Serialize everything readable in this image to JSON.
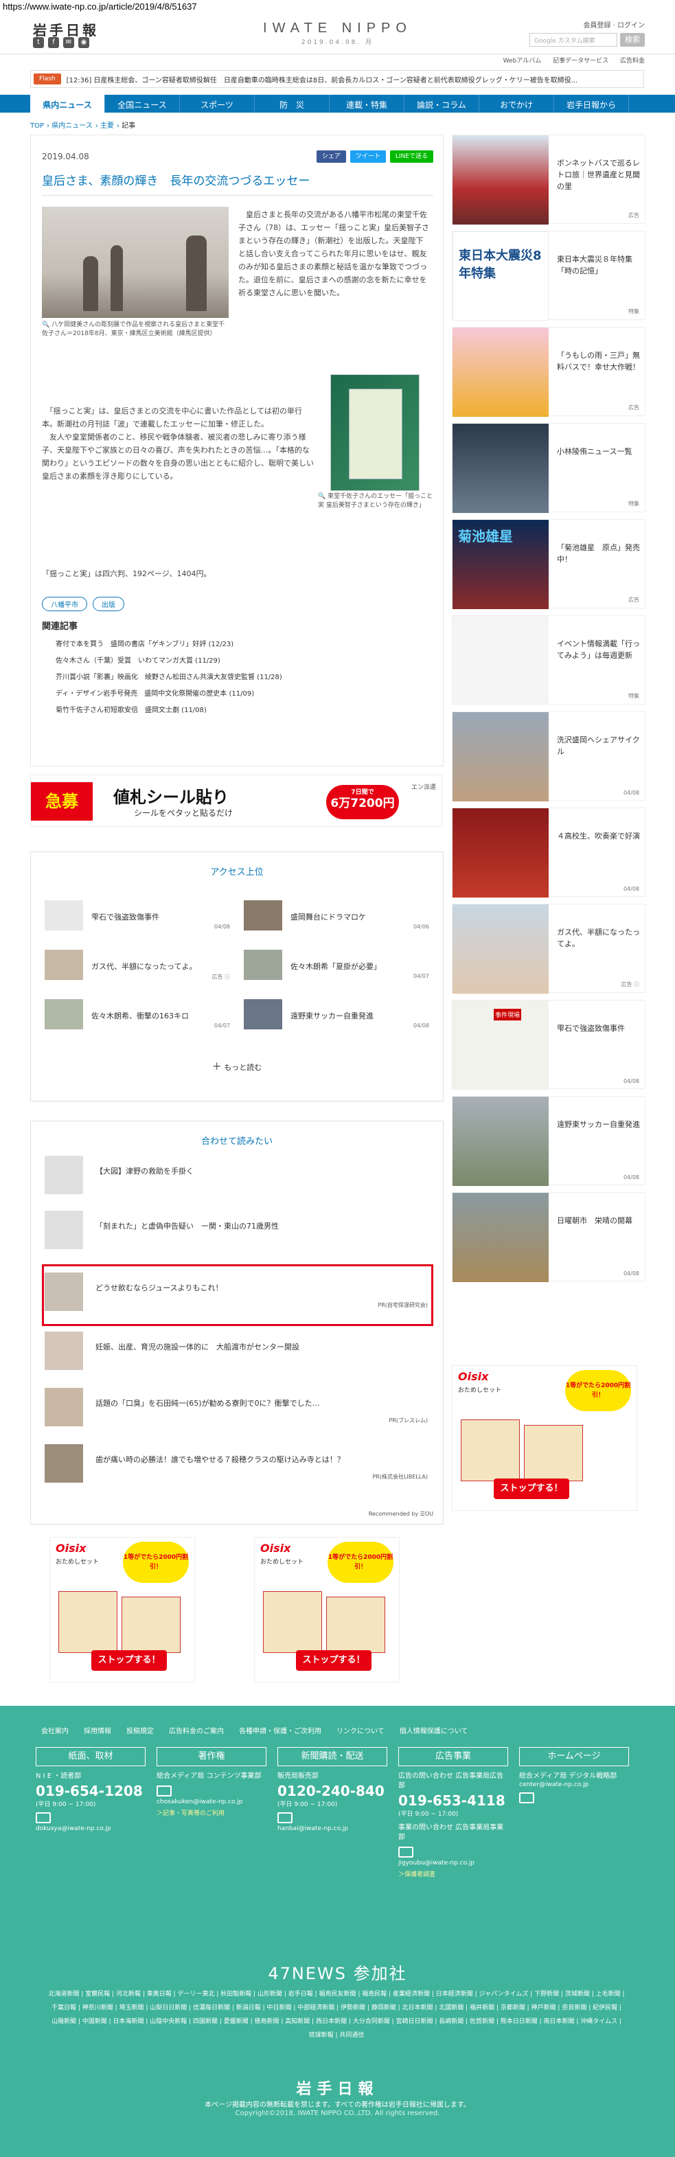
{
  "browser": {
    "url": "https://www.iwate-np.co.jp/article/2019/4/8/51637"
  },
  "header": {
    "logo_left": "岩手日報",
    "logo_center": "IWATE NIPPO",
    "date": "2019.04.08. 月",
    "member": "会員登録 · ログイン",
    "search_placeholder": "Google カスタム検索",
    "search_button": "検索",
    "subnav": [
      "Webアルバム",
      "記事データサービス",
      "広告料金"
    ]
  },
  "flash": {
    "tag": "Flash",
    "text": "[12:36] 日産株主総会、ゴーン容疑者取締役解任　日産自動車の臨時株主総会は8日、前会長カルロス・ゴーン容疑者と前代表取締役グレッグ・ケリー被告を取締役..."
  },
  "nav": [
    "県内ニュース",
    "全国ニュース",
    "スポーツ",
    "防　災",
    "連載・特集",
    "論説・コラム",
    "おでかけ",
    "岩手日報から"
  ],
  "breadcrumb": [
    "TOP",
    "県内ニュース",
    "主要",
    "記事"
  ],
  "article": {
    "date": "2019.04.08",
    "share": {
      "fb": "シェア",
      "tw": "ツイート",
      "line": "LINEで送る"
    },
    "title": "皇后さま、素顔の輝き　長年の交流つづるエッセー",
    "caption1": "八ケ岡健美さんの彫刻展で作品を視察される皇后さまと東堂千佐子さん＝2018年8月、東京・練馬区立美術館（練馬区提供）",
    "para1": "　皇后さまと長年の交流がある八幡平市松尾の東堂千佐子さん（78）は、エッセー「揺っこと実」皇后美智子さまという存在の輝き」（新潮社）を出版した。天皇陛下と話し合い支え合ってこられた年月に思いをはせ、親友のみが知る皇后さまの素顔と秘話を温かな筆致でつづった。退位を前に、皇后さまへの感謝の念を新たに幸せを祈る東堂さんに思いを聞いた。",
    "para2": "　「揺っこと実」は、皇后さまとの交流を中心に書いた作品としては初の単行本。新潮社の月刊誌「波」で連載したエッセーに加筆・修正した。\n　友人や皇室関係者のこと、移民や戦争体験者、被災者の悲しみに寄り添う様子、天皇陛下やご家族との日々の喜び、声を失われたときの苦悩…。「本格的な関わり」というエピソードの数々を自身の思い出とともに紹介し、聡明で美しい皇后さまの素顔を浮き彫りにしている。",
    "caption2": "東堂千佐子さんのエッセー「揺っこと実 皇后美智子さまという存在の輝き」",
    "para3": "「揺っこと実」は四六判、192ページ、1404円。",
    "tags": [
      "八幡平市",
      "出版"
    ],
    "related_heading": "関連記事",
    "related": [
      "寄付で本を買う　盛岡の書店「ゲキンブリ」好評 (12/23)",
      "佐々木さん（千葉）受賞　いわてマンガ大賞 (11/29)",
      "芥川賞小説「影裏」映画化　綾野さん松田さん共演大友啓史監督 (11/28)",
      "ディ・デザイン岩手号発売　盛岡中文化祭開催の歴史本 (11/09)",
      "菊竹千佐子さん初短歌安倍　盛岡文士劇 (11/08)"
    ]
  },
  "ad": {
    "badge": "急募",
    "main": "値札シール貼り",
    "sub": "シールをペタッと貼るだけ",
    "price_line": "7日間で",
    "price": "6万7200円",
    "brand": "エン派遣"
  },
  "ranking": {
    "heading": "アクセス上位",
    "items": [
      {
        "title": "雫石で強盗致傷事件",
        "date": "04/08"
      },
      {
        "title": "盛岡舞台にドラマロケ",
        "date": "04/06"
      },
      {
        "title": "ガス代、半額になったってよ。",
        "date": "広告 ⓘ"
      },
      {
        "title": "佐々木朗希「夏掛が必要」",
        "date": "04/07"
      },
      {
        "title": "佐々木朗希、衝撃の163キロ",
        "date": "04/07"
      },
      {
        "title": "遠野東サッカー自重発進",
        "date": "04/08"
      }
    ],
    "more": "もっと読む"
  },
  "recommend": {
    "heading": "合わせて読みたい",
    "items": [
      {
        "title": "【大図】津野の救助を手掛く",
        "pr": ""
      },
      {
        "title": "「刻まれた」と虚偽申告疑い　一関・東山の71歳男性",
        "pr": ""
      },
      {
        "title": "どうせ飲むならジュースよりもこれ！",
        "pr": "PR(自宅保湿研究会)"
      },
      {
        "title": "妊娠、出産、育児の施設一体的に　大船渡市がセンター開設",
        "pr": ""
      },
      {
        "title": "話題の「口臭」を石田純一(65)が勧める寮則で0に？衝撃でした…",
        "pr": "PR(ブレスレム)"
      },
      {
        "title": "歯が痛い時の必勝法！誰でも増やせる７殺穂クラスの駆け込み寺とは！？",
        "pr": "PR(株式会社LIBELLA)"
      }
    ],
    "credit": "Recommended by ☰OU"
  },
  "oisix": {
    "logo": "Oisix",
    "sub": "おためしセット",
    "circle": "1等がでたら2000円割引！",
    "button": "ストップする！"
  },
  "sidebar": [
    {
      "title": "ボンネットバスで巡るレトロ旅｜世界遺産と見聞の里",
      "date": "広告"
    },
    {
      "title": "東日本大震災８年特集「時の記憶」",
      "date": "特集"
    },
    {
      "title": "「うもしの雨・三戸」無料バスで！幸せ大作戦！",
      "date": "広告"
    },
    {
      "title": "小林陵侑ニュース一覧",
      "date": "特集"
    },
    {
      "title": "「菊池雄星　原点」発売中！",
      "date": "広告"
    },
    {
      "title": "イベント情報満載「行ってみよう」は毎週更新",
      "date": "特集"
    },
    {
      "title": "洗沢盛岡ヘシェアサイクル",
      "date": "04/08"
    },
    {
      "title": "４高校生、吹奏楽で好演",
      "date": "04/08"
    },
    {
      "title": "ガス代、半額になったってよ。",
      "date": "広告 ⓘ"
    },
    {
      "title": "雫石で強盗致傷事件",
      "date": "04/08"
    },
    {
      "title": "遠野東サッカー自重発進",
      "date": "04/08"
    },
    {
      "title": "日曜朝市　栄晴の開幕",
      "date": "04/08"
    }
  ],
  "sidebar_thumb_text": {
    "tohoku": "東日本大震災8年特集",
    "kikuchi": "菊池雄星",
    "jiken": "事件現場"
  },
  "footer": {
    "links": [
      "会社案内",
      "採用情報",
      "投稿規定",
      "広告料金のご案内",
      "各種申請・保護・ご次利用",
      "リンクについて",
      "個人情報保護について"
    ],
    "cols": [
      {
        "h": "紙面、取材",
        "l": "N I E ・読者部",
        "tel": "019-654-1208",
        "s": "(平日 9:00 ~ 17:00)",
        "mail": "dokusya@iwate-np.co.jp",
        "y": ""
      },
      {
        "h": "著作権",
        "l": "総合メディア局 コンテンツ事業部",
        "tel": "",
        "s": "",
        "mail": "chosakuken@iwate-np.co.jp",
        "y": "＞記事・写真等のご利用"
      },
      {
        "h": "新聞購読・配送",
        "l": "販売局販売部",
        "tel": "0120-240-840",
        "s": "(平日 9:00 ~ 17:00)",
        "mail": "hanbai@iwate-np.co.jp",
        "y": ""
      },
      {
        "h": "広告事業",
        "l": "広告の問い合わせ 広告事業局広告部",
        "tel": "019-653-4118",
        "s": "(平日 9:00 ~ 17:00)",
        "mail": "jigyoubu@iwate-np.co.jp",
        "y": "＞保護者調査"
      },
      {
        "h": "ホームページ",
        "l": "総合メディア局 デジタル戦略部",
        "tel": "",
        "s": "",
        "mail": "center@iwate-np.co.jp",
        "y": ""
      }
    ],
    "ads_desk": "事業の問い合わせ 広告事業局事業部",
    "news47": "47NEWS 参加社",
    "papers": "北海道新聞 | 室蘭民報 | 河北新報 | 東奥日報 | デーリー東北 | 秋田魁新報 | 山形新聞 | 岩手日報 | 福島民友新聞 | 福島民報 | 産業経済新聞 | 日本経済新聞 | ジャパンタイムズ | 下野新聞 | 茨城新聞 | 上毛新聞 | 千葉日報 | 神奈川新聞 | 埼玉新聞 | 山梨日日新聞 | 信濃毎日新聞 | 新潟日報 | 中日新聞 | 中部経済新聞 | 伊勢新聞 | 静岡新聞 | 北日本新聞 | 北國新聞 | 福井新聞 | 京都新聞 | 神戸新聞 | 奈良新聞 | 紀伊民報 | 山陽新聞 | 中国新聞 | 日本海新聞 | 山陰中央新報 | 四国新聞 | 愛媛新聞 | 徳島新聞 | 高知新聞 | 西日本新聞 | 大分合同新聞 | 宮崎日日新聞 | 長崎新聞 | 佐賀新聞 | 熊本日日新聞 | 南日本新聞 | 沖縄タイムス | 琉球新報 | 共同通信",
    "logo": "岩手日報",
    "note": "本ページ掲載内容の無断転載を禁じます。すべての著作権は岩手日報社に帰属します。",
    "copyright": "Copyright©2018, IWATE NIPPO CO.,LTD. All rights reserved."
  }
}
